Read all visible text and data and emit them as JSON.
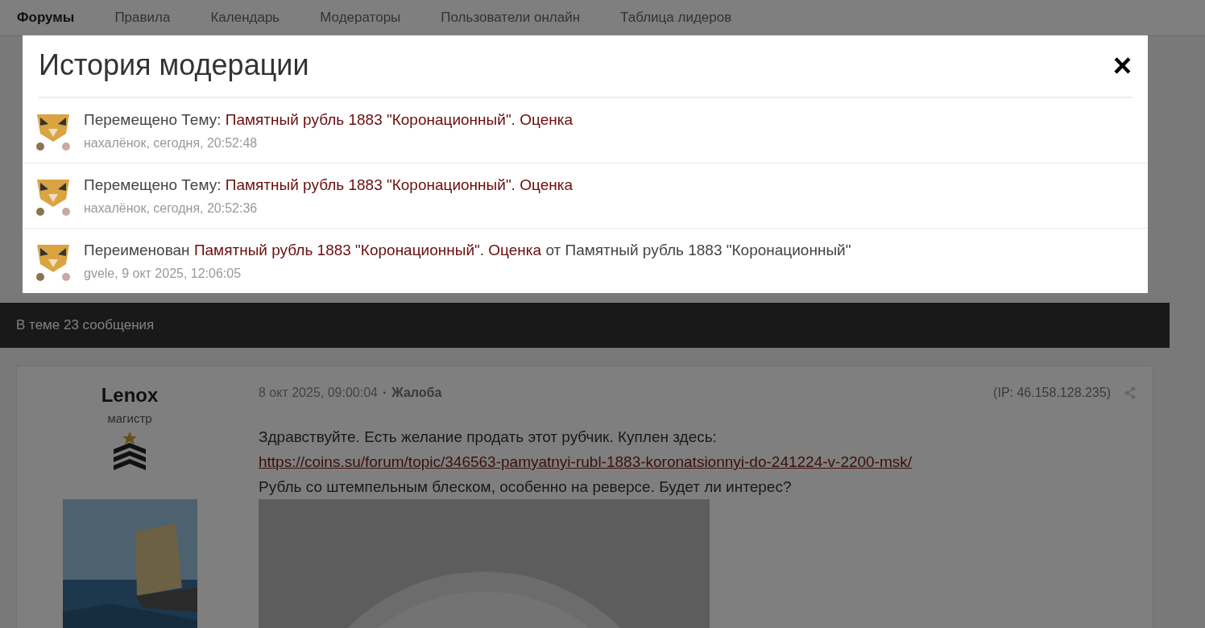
{
  "nav": {
    "items": [
      {
        "label": "Форумы",
        "selected": true
      },
      {
        "label": "Правила",
        "selected": false
      },
      {
        "label": "Календарь",
        "selected": false
      },
      {
        "label": "Модераторы",
        "selected": false
      },
      {
        "label": "Пользователи онлайн",
        "selected": false
      },
      {
        "label": "Таблица лидеров",
        "selected": false
      }
    ]
  },
  "topic_bar": {
    "text": "В теме 23 сообщения"
  },
  "post": {
    "author": "Lenox",
    "rank": "магистр",
    "date": "8 окт 2025, 09:00:04",
    "separator": "·",
    "report": "Жалоба",
    "ip": "(IP: 46.158.128.235)",
    "text_before": "Здравствуйте. Есть желание продать этот рубчик. Куплен здесь:",
    "link": "https://coins.su/forum/topic/346563-pamyatnyi-rubl-1883-koronatsionnyi-do-241224-v-2200-msk/",
    "text_after": "Рубль со штемпельным блеском, особенно на реверсе. Будет ли интерес?"
  },
  "modal": {
    "title": "История модерации",
    "close": "×",
    "entries": [
      {
        "action": "Перемещено Тему:",
        "topic": "Памятный рубль 1883 \"Коронационный\". Оценка",
        "meta": "нахалёнок, сегодня, 20:52:48"
      },
      {
        "action": "Перемещено Тему:",
        "topic": "Памятный рубль 1883 \"Коронационный\". Оценка",
        "meta": "нахалёнок, сегодня, 20:52:36"
      },
      {
        "action": "Переименован",
        "topic": "Памятный рубль 1883 \"Коронационный\". Оценка",
        "suffix": "от Памятный рубль 1883 \"Коронационный\"",
        "meta": "gvele, 9 окт 2025, 12:06:05"
      }
    ]
  }
}
